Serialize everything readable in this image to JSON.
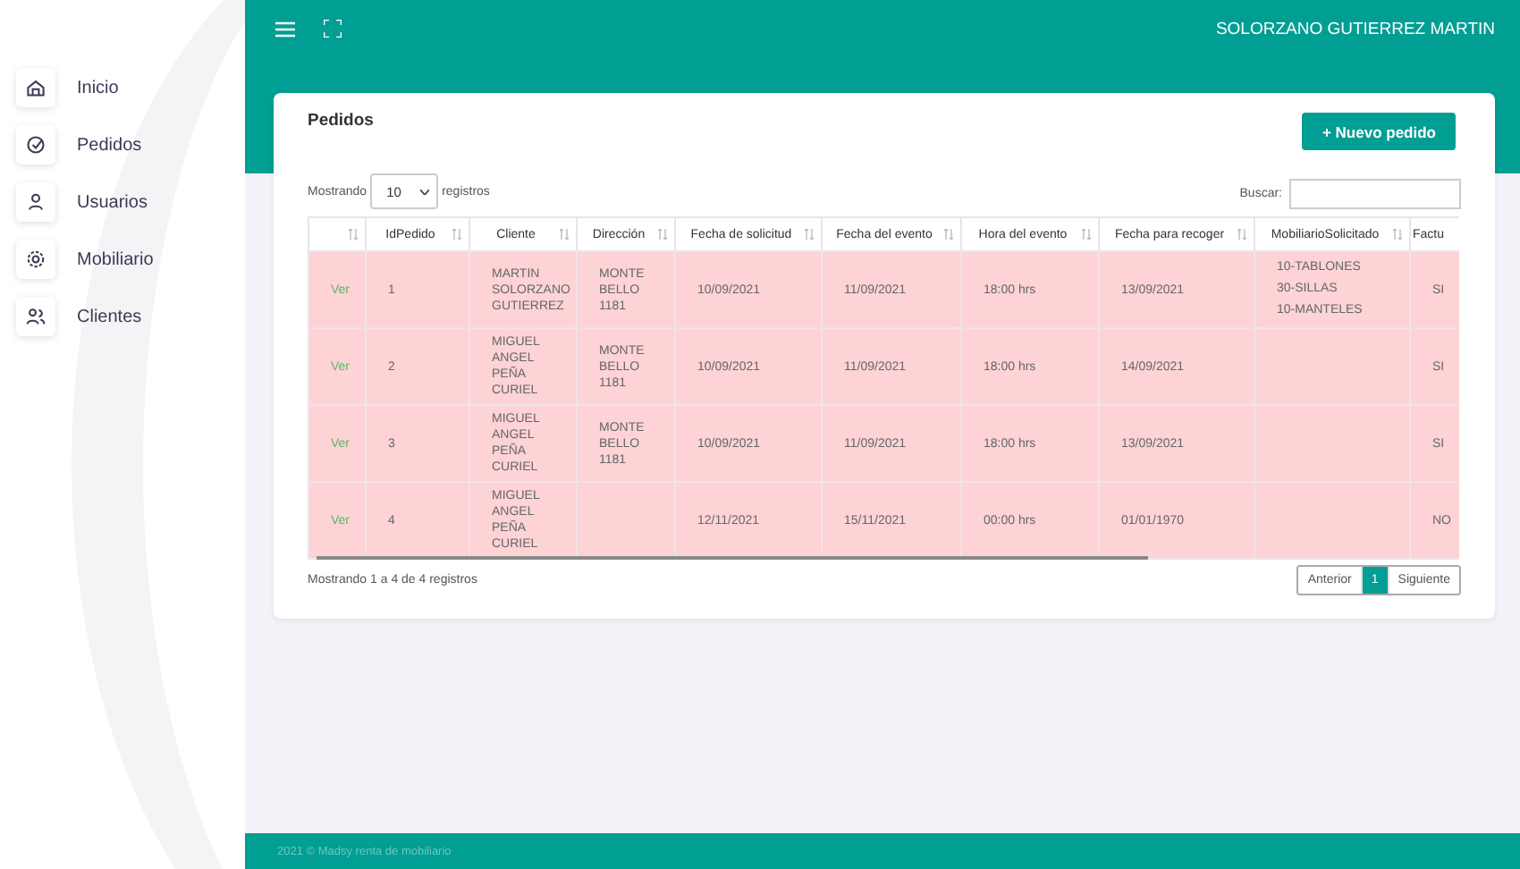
{
  "sidebar": {
    "items": [
      {
        "label": "Inicio",
        "kind": "home"
      },
      {
        "label": "Pedidos",
        "kind": "orders"
      },
      {
        "label": "Usuarios",
        "kind": "users"
      },
      {
        "label": "Mobiliario",
        "kind": "furniture"
      },
      {
        "label": "Clientes",
        "kind": "clients"
      }
    ]
  },
  "topbar": {
    "user": "SOLORZANO GUTIERREZ MARTIN"
  },
  "card": {
    "title": "Pedidos",
    "new_button": "+ Nuevo pedido"
  },
  "length": {
    "prefix": "Mostrando",
    "value": "10",
    "suffix": "registros"
  },
  "search": {
    "label": "Buscar:"
  },
  "table": {
    "columns": [
      "",
      "IdPedido",
      "Cliente",
      "Dirección",
      "Fecha de solicitud",
      "Fecha del evento",
      "Hora del evento",
      "Fecha para recoger",
      "MobiliarioSolicitado",
      "Factu"
    ],
    "rows": [
      {
        "link": "Ver",
        "id": "1",
        "cliente": "MARTIN SOLORZANO GUTIERREZ",
        "direccion": "MONTE BELLO 1181",
        "solicitud": "10/09/2021",
        "evento": "11/09/2021",
        "hora": "18:00 hrs",
        "recoger": "13/09/2021",
        "mobiliario": [
          "10-TABLONES",
          "30-SILLAS",
          "10-MANTELES"
        ],
        "factura": "SI"
      },
      {
        "link": "Ver",
        "id": "2",
        "cliente": "MIGUEL ANGEL PEÑA CURIEL",
        "direccion": "MONTE BELLO 1181",
        "solicitud": "10/09/2021",
        "evento": "11/09/2021",
        "hora": "18:00 hrs",
        "recoger": "14/09/2021",
        "mobiliario": [],
        "factura": "SI"
      },
      {
        "link": "Ver",
        "id": "3",
        "cliente": "MIGUEL ANGEL PEÑA CURIEL",
        "direccion": "MONTE BELLO 1181",
        "solicitud": "10/09/2021",
        "evento": "11/09/2021",
        "hora": "18:00 hrs",
        "recoger": "13/09/2021",
        "mobiliario": [],
        "factura": "SI"
      },
      {
        "link": "Ver",
        "id": "4",
        "cliente": "MIGUEL ANGEL PEÑA CURIEL",
        "direccion": "",
        "solicitud": "12/11/2021",
        "evento": "15/11/2021",
        "hora": "00:00 hrs",
        "recoger": "01/01/1970",
        "mobiliario": [],
        "factura": "NO"
      }
    ]
  },
  "info": "Mostrando 1 a 4 de 4 registros",
  "pagination": [
    {
      "label": "Anterior",
      "selected": false
    },
    {
      "label": "1",
      "selected": true
    },
    {
      "label": "Siguiente",
      "selected": false
    }
  ],
  "footer": "2021 © Madsy renta de mobiliario"
}
